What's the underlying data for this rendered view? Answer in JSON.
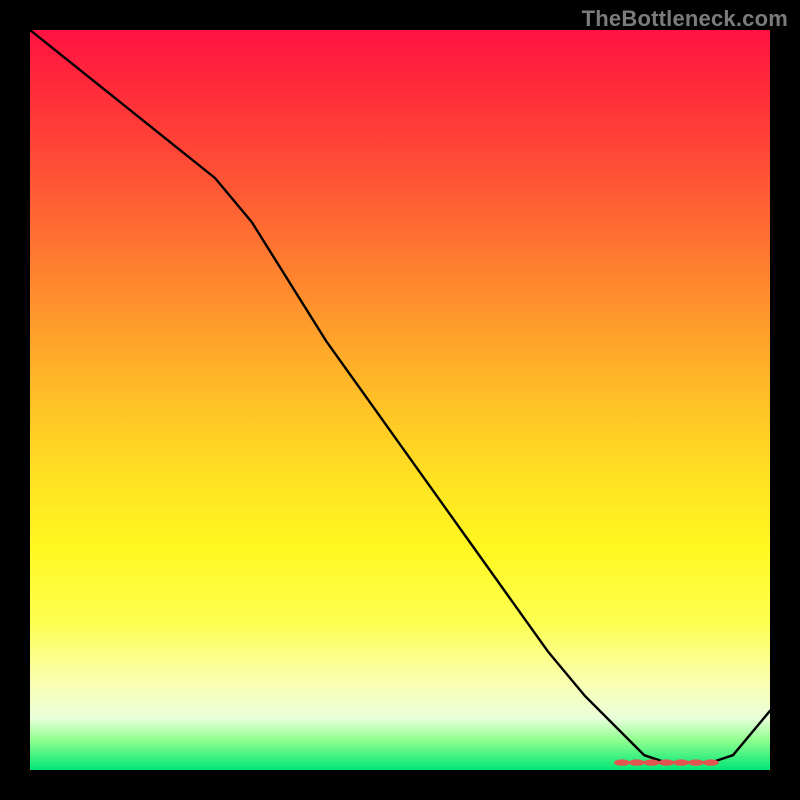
{
  "watermark": "TheBottleneck.com",
  "chart_data": {
    "type": "line",
    "title": "",
    "xlabel": "",
    "ylabel": "",
    "xlim": [
      0,
      100
    ],
    "ylim": [
      0,
      100
    ],
    "grid": false,
    "background_gradient": {
      "orientation": "vertical",
      "stops": [
        {
          "pos": 0,
          "color": "#ff1242"
        },
        {
          "pos": 35,
          "color": "#ff8a2e"
        },
        {
          "pos": 60,
          "color": "#ffe022"
        },
        {
          "pos": 88,
          "color": "#faffb0"
        },
        {
          "pos": 100,
          "color": "#00e676"
        }
      ]
    },
    "series": [
      {
        "name": "bottleneck-curve",
        "color": "#000000",
        "x": [
          0,
          5,
          10,
          15,
          20,
          25,
          30,
          35,
          40,
          45,
          50,
          55,
          60,
          65,
          70,
          75,
          80,
          83,
          86,
          89,
          92,
          95,
          100
        ],
        "y": [
          100,
          96,
          92,
          88,
          84,
          80,
          74,
          66,
          58,
          51,
          44,
          37,
          30,
          23,
          16,
          10,
          5,
          2,
          1,
          1,
          1,
          2,
          8
        ]
      }
    ],
    "markers": {
      "name": "optimal-range",
      "color": "#e0554f",
      "shape": "rounded",
      "x": [
        80,
        82,
        84,
        86,
        88,
        90,
        92
      ],
      "y": [
        1,
        1,
        1,
        1,
        1,
        1,
        1
      ]
    }
  }
}
